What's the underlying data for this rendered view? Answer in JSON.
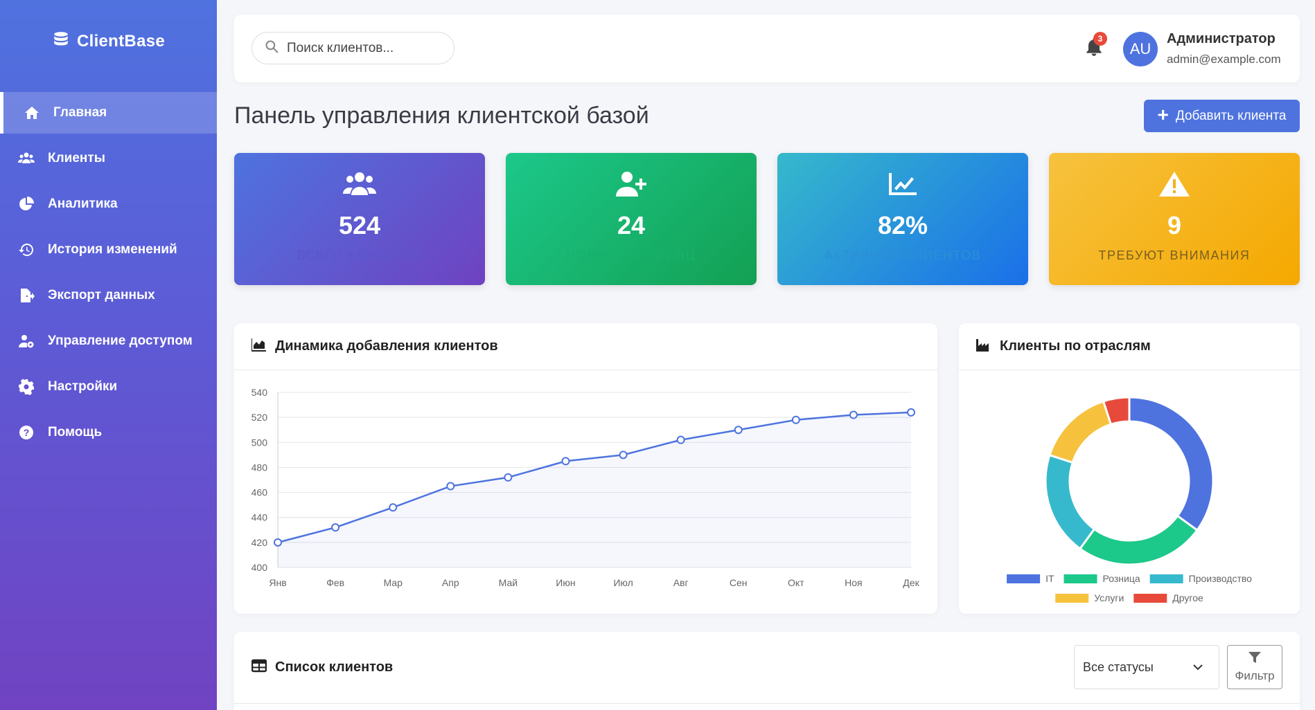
{
  "sidebar": {
    "brand": "ClientBase",
    "items": [
      {
        "label": "Главная",
        "icon": "home-icon",
        "active": true
      },
      {
        "label": "Клиенты",
        "icon": "users-icon"
      },
      {
        "label": "Аналитика",
        "icon": "pie-chart-icon"
      },
      {
        "label": "История изменений",
        "icon": "history-icon"
      },
      {
        "label": "Экспорт данных",
        "icon": "file-export-icon"
      },
      {
        "label": "Управление доступом",
        "icon": "user-cog-icon"
      },
      {
        "label": "Настройки",
        "icon": "gear-icon"
      },
      {
        "label": "Помощь",
        "icon": "help-icon"
      }
    ]
  },
  "topbar": {
    "search_placeholder": "Поиск клиентов...",
    "notifications_count": "3",
    "avatar_initials": "AU",
    "user_name": "Администратор",
    "user_email": "admin@example.com"
  },
  "page": {
    "title": "Панель управления клиентской базой",
    "add_button": "Добавить клиента"
  },
  "stats": [
    {
      "value": "524",
      "label": "Всего клиентов",
      "icon": "users-icon"
    },
    {
      "value": "24",
      "label": "Новых за месяц",
      "icon": "user-plus-icon"
    },
    {
      "value": "82%",
      "label": "Активных клиентов",
      "icon": "chart-line-icon"
    },
    {
      "value": "9",
      "label": "Требуют внимания",
      "icon": "warning-icon"
    }
  ],
  "line_card": {
    "title": "Динамика добавления клиентов"
  },
  "donut_card": {
    "title": "Клиенты по отраслям"
  },
  "list_card": {
    "title": "Список клиентов",
    "status_select": "Все статусы",
    "filter_button": "Фильтр"
  },
  "colors": {
    "accent": "#4e73df",
    "line": "#4e73df"
  },
  "chart_data": [
    {
      "type": "line",
      "categories": [
        "Янв",
        "Фев",
        "Мар",
        "Апр",
        "Май",
        "Июн",
        "Июл",
        "Авг",
        "Сен",
        "Окт",
        "Ноя",
        "Дек"
      ],
      "values": [
        420,
        432,
        448,
        465,
        472,
        485,
        490,
        502,
        510,
        518,
        522,
        524
      ],
      "ylim": [
        400,
        540
      ],
      "yticks": [
        400,
        420,
        440,
        460,
        480,
        500,
        520,
        540
      ],
      "grid": true
    },
    {
      "type": "pie",
      "categories": [
        "IT",
        "Розница",
        "Производство",
        "Услуги",
        "Другое"
      ],
      "values": [
        35,
        25,
        20,
        15,
        5
      ],
      "colors": [
        "#4e73df",
        "#1cc88a",
        "#36b9cc",
        "#f6c23e",
        "#e74a3b"
      ],
      "legend": "bottom"
    }
  ]
}
